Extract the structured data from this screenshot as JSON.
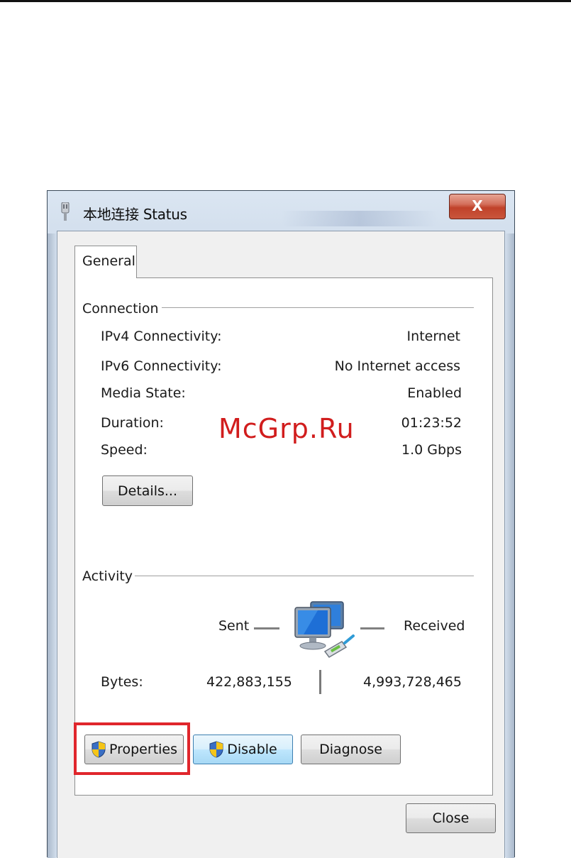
{
  "window": {
    "title": "本地连接 Status",
    "close_symbol": "X"
  },
  "tabs": [
    {
      "label": "General"
    }
  ],
  "connection": {
    "heading": "Connection",
    "fields": [
      {
        "label": "IPv4 Connectivity:",
        "value": "Internet"
      },
      {
        "label": "IPv6 Connectivity:",
        "value": "No Internet access"
      },
      {
        "label": "Media State:",
        "value": "Enabled"
      },
      {
        "label": "Duration:",
        "value": "01:23:52"
      },
      {
        "label": "Speed:",
        "value": "1.0 Gbps"
      }
    ],
    "details_button": "Details..."
  },
  "activity": {
    "heading": "Activity",
    "sent_label": "Sent",
    "received_label": "Received",
    "bytes_label": "Bytes:",
    "bytes_sent": "422,883,155",
    "bytes_received": "4,993,728,465"
  },
  "buttons": {
    "properties": "Properties",
    "disable": "Disable",
    "diagnose": "Diagnose",
    "close": "Close"
  },
  "watermark": "McGrp.Ru",
  "colors": {
    "highlight_box": "#e0262c",
    "watermark": "#d11d1d",
    "close_button": "#c0422a"
  },
  "icons": {
    "app": "network-connection-icon",
    "activity": "network-computers-icon",
    "uac": "uac-shield-icon"
  }
}
